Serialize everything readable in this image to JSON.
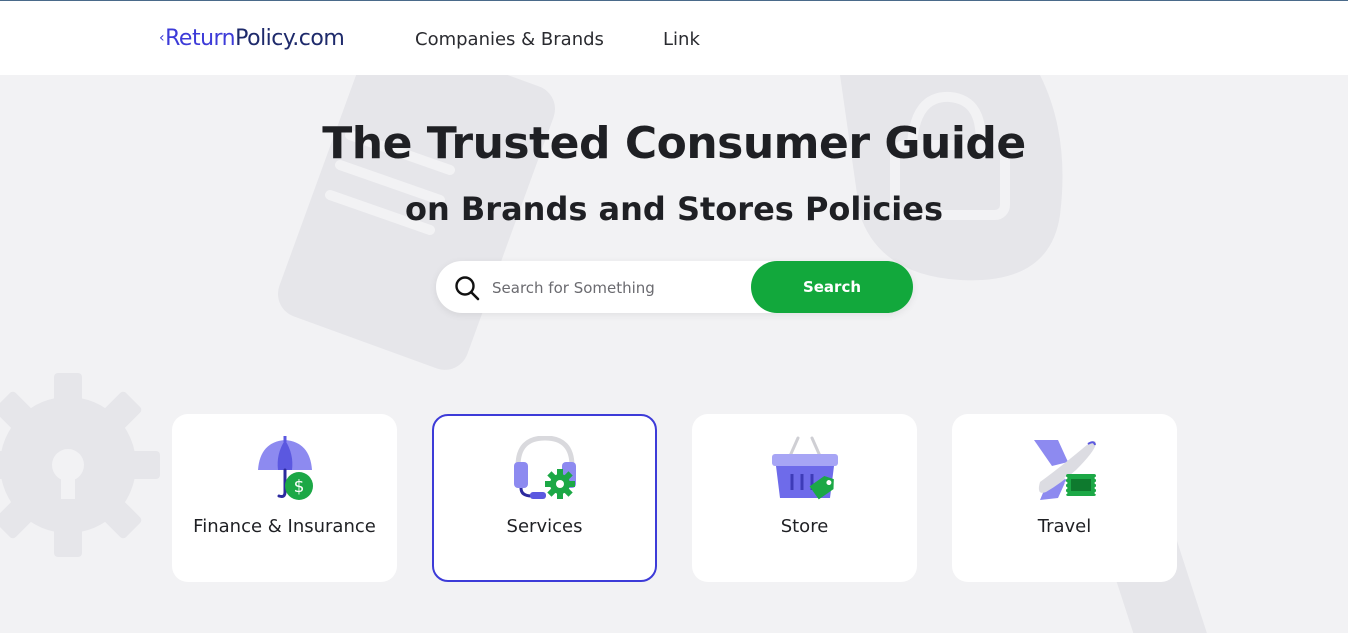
{
  "header": {
    "logo_arrow": "‹",
    "logo_part1": "Return",
    "logo_part2": "Policy.com",
    "nav": [
      "Companies & Brands",
      "Link"
    ]
  },
  "hero": {
    "title": "The Trusted Consumer Guide",
    "subtitle": "on Brands and Stores Policies"
  },
  "search": {
    "placeholder": "Search for Something",
    "value": "",
    "button_label": "Search"
  },
  "categories": [
    {
      "label": "Finance & Insurance",
      "icon": "umbrella-dollar-icon",
      "active": false
    },
    {
      "label": "Services",
      "icon": "headset-gear-icon",
      "active": true
    },
    {
      "label": "Store",
      "icon": "basket-tag-icon",
      "active": false
    },
    {
      "label": "Travel",
      "icon": "airplane-ticket-icon",
      "active": false
    }
  ],
  "colors": {
    "brand": "#3d3bd8",
    "brand_dark": "#1e2a6b",
    "accent_green": "#12a83c",
    "background": "#f2f2f4"
  }
}
